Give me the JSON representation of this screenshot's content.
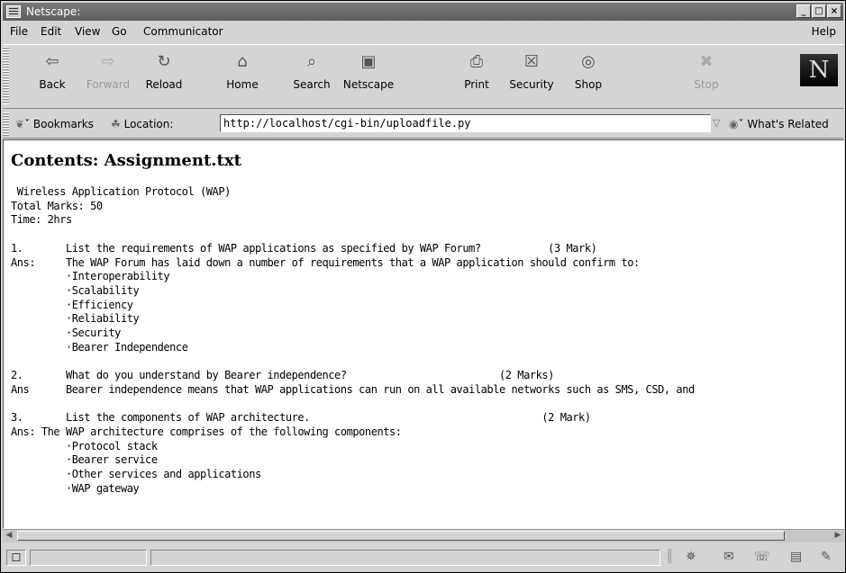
{
  "window": {
    "title": "Netscape:"
  },
  "menu": {
    "items": [
      "File",
      "Edit",
      "View",
      "Go",
      "Communicator"
    ],
    "help": "Help"
  },
  "toolbar": {
    "buttons": [
      {
        "label": "Back",
        "icon": "back-arrow-icon",
        "enabled": true
      },
      {
        "label": "Forward",
        "icon": "forward-arrow-icon",
        "enabled": false
      },
      {
        "label": "Reload",
        "icon": "reload-icon",
        "enabled": true
      },
      {
        "label": "Home",
        "icon": "home-icon",
        "enabled": true
      },
      {
        "label": "Search",
        "icon": "search-icon",
        "enabled": true
      },
      {
        "label": "Netscape",
        "icon": "netscape-icon",
        "enabled": true
      },
      {
        "label": "Print",
        "icon": "print-icon",
        "enabled": true
      },
      {
        "label": "Security",
        "icon": "lock-icon",
        "enabled": true
      },
      {
        "label": "Shop",
        "icon": "shop-icon",
        "enabled": true
      },
      {
        "label": "Stop",
        "icon": "stop-icon",
        "enabled": false
      }
    ],
    "logo": "N"
  },
  "location": {
    "bookmarks_label": "Bookmarks",
    "location_label": "Location:",
    "url": "http://localhost/cgi-bin/uploadfile.py",
    "related_label": "What's Related"
  },
  "page": {
    "heading": "Contents: Assignment.txt",
    "body": " Wireless Application Protocol (WAP)\nTotal Marks: 50\nTime: 2hrs\n\n1.       List the requirements of WAP applications as specified by WAP Forum?           (3 Mark)\nAns:     The WAP Forum has laid down a number of requirements that a WAP application should confirm to:\n         ·Interoperability\n         ·Scalability\n         ·Efficiency\n         ·Reliability\n         ·Security\n         ·Bearer Independence\n\n2.       What do you understand by Bearer independence?                         (2 Marks)\nAns      Bearer independence means that WAP applications can run on all available networks such as SMS, CSD, and\n\n3.       List the components of WAP architecture.                                      (2 Mark)\nAns: The WAP architecture comprises of the following components:\n         ·Protocol stack\n         ·Bearer service\n         ·Other services and applications\n         ·WAP gateway"
  }
}
